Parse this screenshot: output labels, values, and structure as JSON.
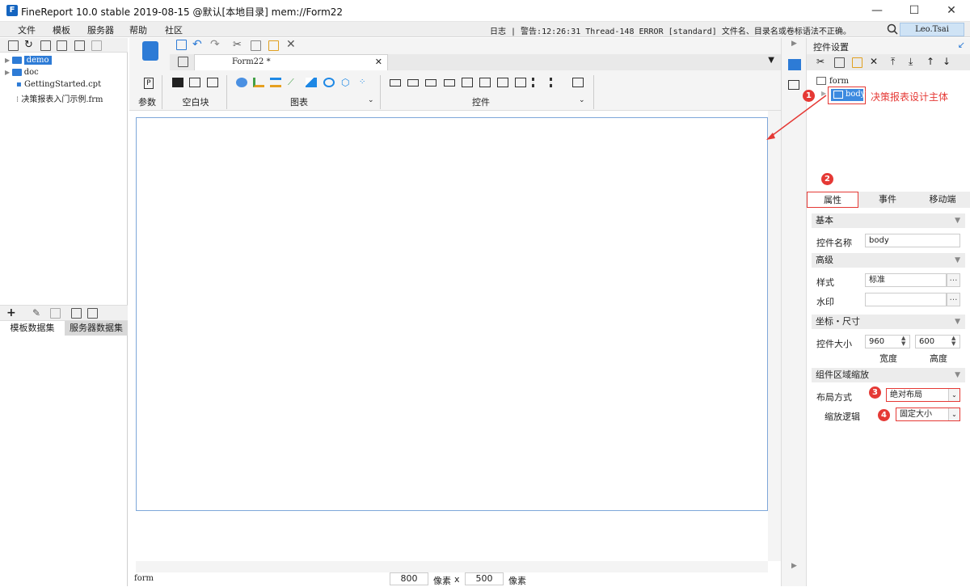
{
  "window": {
    "title": "FineReport 10.0 stable 2019-08-15 @默认[本地目录]    mem://Form22",
    "logo": "F",
    "minimize": "—",
    "maximize": "☐",
    "close": "✕"
  },
  "menu": {
    "items": [
      "文件",
      "模板",
      "服务器",
      "帮助",
      "社区"
    ],
    "log": "日志 | 警告:12:26:31 Thread-148 ERROR [standard] 文件名、目录名或卷标语法不正确。",
    "user": "Leo.Tsai"
  },
  "left_panel": {
    "tree": [
      "demo",
      "doc",
      "GettingStarted.cpt",
      "决策报表入门示例.frm"
    ],
    "bottom_tabs": [
      "模板数据集",
      "服务器数据集"
    ]
  },
  "ribbon": {
    "groups": [
      "参数",
      "空白块",
      "图表",
      "控件"
    ],
    "doc_tab": "Form22 *"
  },
  "status": {
    "left_label": "form",
    "width_value": "800",
    "width_unit": "像素",
    "x": "x",
    "height_value": "500",
    "height_unit": "像素"
  },
  "right_panel": {
    "title": "控件设置",
    "tree_root": "form",
    "tree_child": "body",
    "annotation_label": "决策报表设计主体",
    "tabs": [
      "属性",
      "事件",
      "移动端"
    ],
    "sections": {
      "basic": "基本",
      "advanced": "高级",
      "coords": "坐标・尺寸",
      "zoom": "组件区域缩放"
    },
    "fields": {
      "name_label": "控件名称",
      "name_value": "body",
      "style_label": "样式",
      "style_value": "标准",
      "watermark_label": "水印",
      "watermark_value": "",
      "size_label": "控件大小",
      "width_value": "960",
      "height_value": "600",
      "width_caption": "宽度",
      "height_caption": "高度",
      "layout_label": "布局方式",
      "layout_value": "绝对布局",
      "scale_label": "缩放逻辑",
      "scale_value": "固定大小"
    },
    "markers": [
      "1",
      "2",
      "3",
      "4"
    ]
  }
}
